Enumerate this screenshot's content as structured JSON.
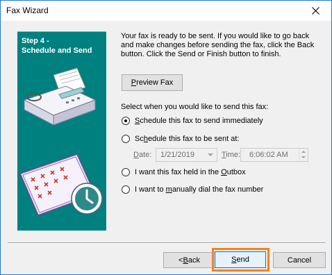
{
  "window": {
    "title": "Fax Wizard"
  },
  "sidebar": {
    "step_line1": "Step 4 -",
    "step_line2": "Schedule and Send"
  },
  "intro_text": "Your fax is ready to be sent.  If you would like to go back and make changes before sending the fax, click the Back button.  Click the Send or Finish button to finish.",
  "preview_button": {
    "accel": "P",
    "rest": "review Fax"
  },
  "prompt": "Select when you would like to send this fax:",
  "options": [
    {
      "accel": "S",
      "rest": "chedule this fax to send immediately",
      "checked": true
    },
    {
      "pre": "Sc",
      "accel": "h",
      "rest": "edule this fax to be sent at:",
      "checked": false
    },
    {
      "pre": "I want this fax held in the ",
      "accel": "O",
      "rest": "utbox",
      "checked": false
    },
    {
      "pre": "I want to ",
      "accel": "m",
      "rest": "anually dial the fax number",
      "checked": false
    }
  ],
  "schedule": {
    "date_label_accel": "D",
    "date_label_rest": "ate:",
    "date_value": "1/21/2019",
    "time_label_accel": "T",
    "time_label_rest": "ime:",
    "time_value": "6:06:02 AM"
  },
  "buttons": {
    "back": {
      "pre": "< ",
      "accel": "B",
      "rest": "ack"
    },
    "send": {
      "accel": "S",
      "rest": "end"
    },
    "cancel": {
      "label": "Cancel"
    }
  },
  "colors": {
    "panel": "#018080",
    "highlight": "#f58220",
    "titlebar": "#ffffff"
  }
}
